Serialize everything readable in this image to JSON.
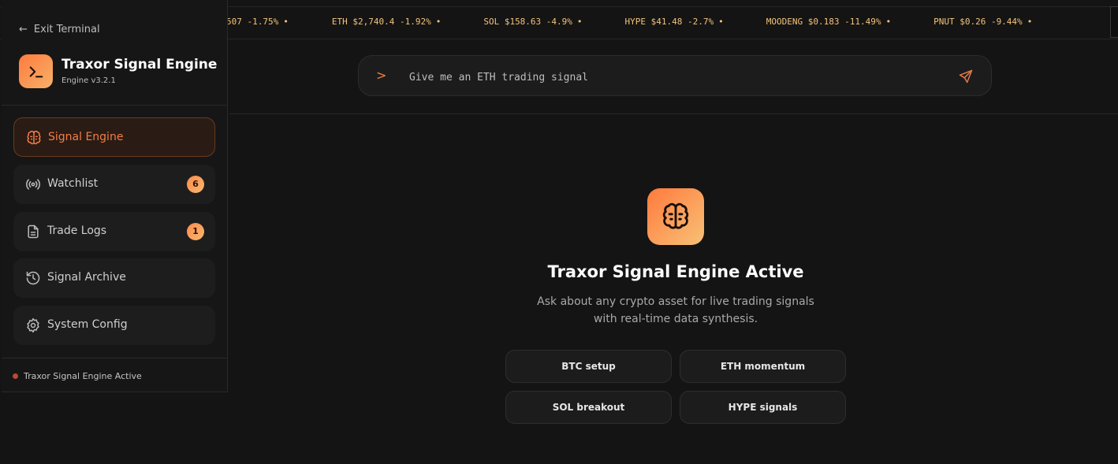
{
  "ticker": {
    "items": [
      {
        "text": "507 -1.75%"
      },
      {
        "text": "ETH $2,740.4 -1.92%"
      },
      {
        "text": "SOL $158.63 -4.9%"
      },
      {
        "text": "HYPE $41.48 -2.7%"
      },
      {
        "text": "MOODENG $0.183 -11.49%"
      },
      {
        "text": "PNUT $0.26 -9.44%"
      }
    ],
    "separator": "•",
    "color": "#f3c37a"
  },
  "prompt": {
    "chevron": ">",
    "placeholder": "Give me an ETH trading signal",
    "send_icon": "send-icon"
  },
  "sidebar": {
    "exit_label": "Exit Terminal",
    "app_title": "Traxor Signal Engine",
    "app_version": "Engine v3.2.1",
    "items": [
      {
        "label": "Signal Engine",
        "icon": "brain-icon",
        "active": true
      },
      {
        "label": "Watchlist",
        "icon": "radio-signal-icon",
        "badge": "6"
      },
      {
        "label": "Trade Logs",
        "icon": "document-icon",
        "badge": "1"
      },
      {
        "label": "Signal Archive",
        "icon": "history-icon"
      },
      {
        "label": "System Config",
        "icon": "gear-icon"
      }
    ],
    "status": "Traxor Signal Engine Active"
  },
  "main": {
    "title": "Traxor Signal Engine Active",
    "subtitle_line1": "Ask about any crypto asset for live trading signals",
    "subtitle_line2": "with real-time data synthesis.",
    "suggestions": [
      "BTC setup",
      "ETH momentum",
      "SOL breakout",
      "HYPE signals"
    ]
  },
  "colors": {
    "accent": "#f37d45",
    "background": "#141414",
    "sidebar": "#161616"
  }
}
